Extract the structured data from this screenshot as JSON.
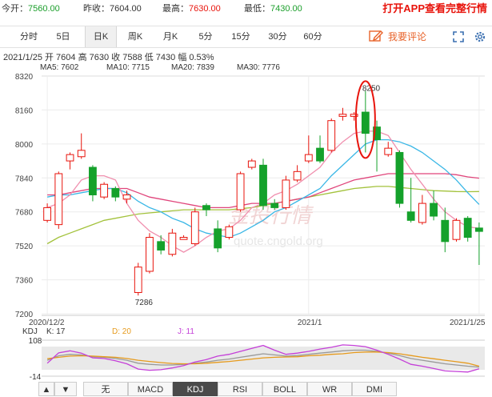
{
  "quote": {
    "open_label": "今开：",
    "open_value": "7560.00",
    "prev_label": "昨收：",
    "prev_value": "7604.00",
    "high_label": "最高：",
    "high_value": "7630.00",
    "low_label": "最低：",
    "low_value": "7430.00",
    "promo": "打开APP查看完整行情"
  },
  "tabs": [
    {
      "label": "分时"
    },
    {
      "label": "5日"
    },
    {
      "label": "日K",
      "active": true
    },
    {
      "label": "周K"
    },
    {
      "label": "月K"
    },
    {
      "label": "5分"
    },
    {
      "label": "15分"
    },
    {
      "label": "30分"
    },
    {
      "label": "60分"
    }
  ],
  "comment_label": "我要评论",
  "info_line": "2021/1/25  开 7604  高 7630  收 7588  低 7430  幅 0.53%",
  "ma": [
    {
      "label": "MA5: 7602",
      "color": "#f08fae"
    },
    {
      "label": "MA10: 7715",
      "color": "#3ab7e6"
    },
    {
      "label": "MA20: 7839",
      "color": "#e0457b"
    },
    {
      "label": "MA30: 7776",
      "color": "#a3c23c"
    }
  ],
  "watermark": {
    "cn": "金投行情",
    "url": "quote.cngold.org"
  },
  "chart_data": {
    "type": "candlestick",
    "y_ticks": [
      "8320",
      "8160",
      "8000",
      "7840",
      "7680",
      "7520",
      "7360",
      "7200"
    ],
    "ylim": [
      7200,
      8320
    ],
    "x_labels": [
      {
        "text": "2020/12/2",
        "index": 0
      },
      {
        "text": "2021/1",
        "index": 23
      },
      {
        "text": "2021/1/25",
        "index": 38
      }
    ],
    "annotations": [
      {
        "text": "8250",
        "index": 28,
        "value": 8250
      },
      {
        "text": "7286",
        "index": 8,
        "value": 7286
      }
    ],
    "candles": [
      {
        "o": 7640,
        "c": 7700,
        "h": 7720,
        "l": 7630
      },
      {
        "o": 7620,
        "c": 7860,
        "h": 7870,
        "l": 7600
      },
      {
        "o": 7920,
        "c": 7950,
        "h": 7960,
        "l": 7880
      },
      {
        "o": 7940,
        "c": 7970,
        "h": 8050,
        "l": 7930
      },
      {
        "o": 7890,
        "c": 7760,
        "h": 7900,
        "l": 7730
      },
      {
        "o": 7750,
        "c": 7810,
        "h": 7820,
        "l": 7740
      },
      {
        "o": 7790,
        "c": 7750,
        "h": 7800,
        "l": 7730
      },
      {
        "o": 7740,
        "c": 7760,
        "h": 7780,
        "l": 7720
      },
      {
        "o": 7300,
        "c": 7420,
        "h": 7440,
        "l": 7286
      },
      {
        "o": 7400,
        "c": 7560,
        "h": 7580,
        "l": 7390
      },
      {
        "o": 7540,
        "c": 7500,
        "h": 7570,
        "l": 7480
      },
      {
        "o": 7480,
        "c": 7580,
        "h": 7600,
        "l": 7470
      },
      {
        "o": 7550,
        "c": 7560,
        "h": 7570,
        "l": 7550
      },
      {
        "o": 7530,
        "c": 7680,
        "h": 7700,
        "l": 7520
      },
      {
        "o": 7710,
        "c": 7690,
        "h": 7720,
        "l": 7660
      },
      {
        "o": 7600,
        "c": 7510,
        "h": 7640,
        "l": 7490
      },
      {
        "o": 7560,
        "c": 7610,
        "h": 7620,
        "l": 7550
      },
      {
        "o": 7690,
        "c": 7860,
        "h": 7870,
        "l": 7680
      },
      {
        "o": 7890,
        "c": 7920,
        "h": 7930,
        "l": 7880
      },
      {
        "o": 7900,
        "c": 7710,
        "h": 7930,
        "l": 7690
      },
      {
        "o": 7720,
        "c": 7700,
        "h": 7740,
        "l": 7690
      },
      {
        "o": 7700,
        "c": 7830,
        "h": 7850,
        "l": 7690
      },
      {
        "o": 7830,
        "c": 7870,
        "h": 7900,
        "l": 7820
      },
      {
        "o": 7920,
        "c": 7950,
        "h": 8040,
        "l": 7910
      },
      {
        "o": 7980,
        "c": 7920,
        "h": 8040,
        "l": 7910
      },
      {
        "o": 7970,
        "c": 8110,
        "h": 8120,
        "l": 7960
      },
      {
        "o": 8130,
        "c": 8140,
        "h": 8170,
        "l": 8110
      },
      {
        "o": 8130,
        "c": 8140,
        "h": 8150,
        "l": 8110
      },
      {
        "o": 8150,
        "c": 8050,
        "h": 8250,
        "l": 7960
      },
      {
        "o": 8080,
        "c": 8020,
        "h": 8110,
        "l": 7870
      },
      {
        "o": 7950,
        "c": 7980,
        "h": 8010,
        "l": 7940
      },
      {
        "o": 7960,
        "c": 7720,
        "h": 7970,
        "l": 7700
      },
      {
        "o": 7680,
        "c": 7640,
        "h": 7840,
        "l": 7630
      },
      {
        "o": 7630,
        "c": 7720,
        "h": 7760,
        "l": 7620
      },
      {
        "o": 7720,
        "c": 7660,
        "h": 7780,
        "l": 7640
      },
      {
        "o": 7640,
        "c": 7540,
        "h": 7700,
        "l": 7490
      },
      {
        "o": 7550,
        "c": 7640,
        "h": 7650,
        "l": 7540
      },
      {
        "o": 7650,
        "c": 7560,
        "h": 7660,
        "l": 7540
      },
      {
        "o": 7604,
        "c": 7588,
        "h": 7630,
        "l": 7430
      }
    ],
    "ma5": [
      7700,
      7720,
      7760,
      7830,
      7850,
      7850,
      7830,
      7720,
      7640,
      7590,
      7560,
      7520,
      7490,
      7520,
      7560,
      7590,
      7600,
      7640,
      7700,
      7720,
      7760,
      7780,
      7810,
      7850,
      7890,
      7960,
      8010,
      8050,
      8060,
      8060,
      8040,
      7960,
      7880,
      7810,
      7740,
      7680,
      7640,
      7610,
      7602
    ],
    "ma10": [
      7750,
      7760,
      7760,
      7770,
      7780,
      7790,
      7790,
      7770,
      7730,
      7700,
      7680,
      7650,
      7630,
      7600,
      7580,
      7570,
      7560,
      7580,
      7610,
      7640,
      7680,
      7700,
      7730,
      7760,
      7790,
      7850,
      7900,
      7950,
      8000,
      8020,
      8020,
      8010,
      7990,
      7960,
      7920,
      7880,
      7830,
      7770,
      7715
    ],
    "ma20": [
      7760,
      7760,
      7770,
      7780,
      7790,
      7790,
      7790,
      7790,
      7770,
      7750,
      7740,
      7730,
      7720,
      7710,
      7700,
      7700,
      7700,
      7710,
      7720,
      7720,
      7720,
      7730,
      7740,
      7750,
      7770,
      7790,
      7810,
      7830,
      7840,
      7850,
      7860,
      7860,
      7860,
      7860,
      7860,
      7860,
      7855,
      7845,
      7839
    ],
    "ma30": [
      7530,
      7560,
      7580,
      7600,
      7620,
      7640,
      7650,
      7660,
      7670,
      7675,
      7680,
      7685,
      7690,
      7690,
      7690,
      7690,
      7690,
      7695,
      7700,
      7710,
      7720,
      7730,
      7740,
      7750,
      7760,
      7770,
      7780,
      7790,
      7795,
      7800,
      7800,
      7795,
      7790,
      7785,
      7780,
      7778,
      7776,
      7775,
      7776
    ],
    "kdj": {
      "ylim": [
        -14,
        108
      ],
      "y_ticks": [
        "108",
        "-14"
      ],
      "k": [
        40,
        55,
        60,
        58,
        52,
        50,
        46,
        40,
        30,
        26,
        24,
        24,
        26,
        30,
        34,
        40,
        44,
        50,
        56,
        62,
        58,
        54,
        56,
        60,
        64,
        68,
        72,
        74,
        74,
        70,
        64,
        56,
        46,
        40,
        34,
        28,
        24,
        20,
        17
      ],
      "d": [
        45,
        50,
        54,
        55,
        54,
        52,
        50,
        46,
        40,
        36,
        32,
        29,
        28,
        28,
        30,
        33,
        36,
        40,
        44,
        48,
        50,
        51,
        52,
        55,
        57,
        60,
        62,
        66,
        68,
        68,
        66,
        62,
        56,
        50,
        45,
        40,
        35,
        30,
        20
      ],
      "j": [
        30,
        65,
        72,
        64,
        48,
        46,
        38,
        28,
        10,
        6,
        8,
        14,
        22,
        34,
        42,
        54,
        60,
        70,
        80,
        90,
        74,
        60,
        64,
        70,
        78,
        84,
        92,
        90,
        86,
        74,
        60,
        44,
        26,
        20,
        12,
        4,
        2,
        0,
        11
      ],
      "k_label": "K: 17",
      "d_label": "D: 20",
      "j_label": "J: 11",
      "title": "KDJ"
    }
  },
  "indicators": [
    {
      "label": "▲"
    },
    {
      "label": "▼"
    },
    {
      "label": "无"
    },
    {
      "label": "MACD"
    },
    {
      "label": "KDJ",
      "active": true
    },
    {
      "label": "RSI"
    },
    {
      "label": "BOLL"
    },
    {
      "label": "WR"
    },
    {
      "label": "DMI"
    }
  ]
}
